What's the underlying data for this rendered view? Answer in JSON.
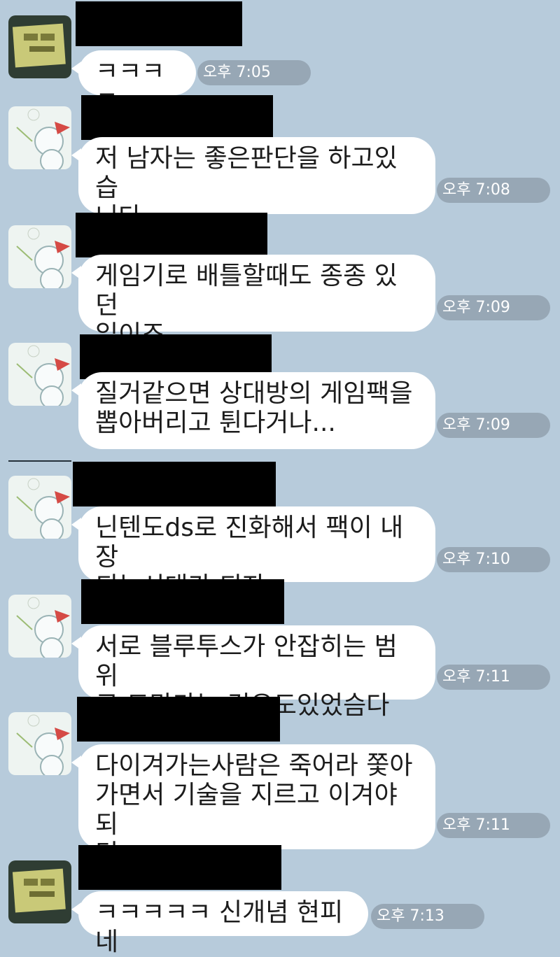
{
  "messages": [
    {
      "text": "ㅋㅋㅋㅋ",
      "time": "오후 7:05",
      "avatar": "sticky-note-avatar"
    },
    {
      "text": "저 남자는 좋은판단을 하고있습\n니다",
      "time": "오후 7:08",
      "avatar": "snowman-avatar"
    },
    {
      "text": "게임기로 배틀할때도 종종 있던\n일이죠...",
      "time": "오후 7:09",
      "avatar": "snowman-avatar"
    },
    {
      "text": "질거같으면 상대방의 게임팩을\n뽑아버리고 튄다거나...",
      "time": "오후 7:09",
      "avatar": "snowman-avatar"
    },
    {
      "text": "닌텐도ds로 진화해서 팩이 내장\n되는시대가 되자",
      "time": "오후 7:10",
      "avatar": "snowman-avatar"
    },
    {
      "text": "서로 블루투스가 안잡히는 범위\n로 도망가는 경우도있었슴다",
      "time": "오후 7:11",
      "avatar": "snowman-avatar"
    },
    {
      "text": "다이겨가는사람은 죽어라 쫓아\n가면서 기술을 지르고 이겨야되\n던...",
      "time": "오후 7:11",
      "avatar": "snowman-avatar"
    },
    {
      "text": "ㅋㅋㅋㅋㅋ 신개념 현피네",
      "time": "오후 7:13",
      "avatar": "sticky-note-avatar"
    }
  ],
  "colors": {
    "background": "#b7cbdb",
    "bubble": "#ffffff",
    "redaction": "#000000"
  }
}
